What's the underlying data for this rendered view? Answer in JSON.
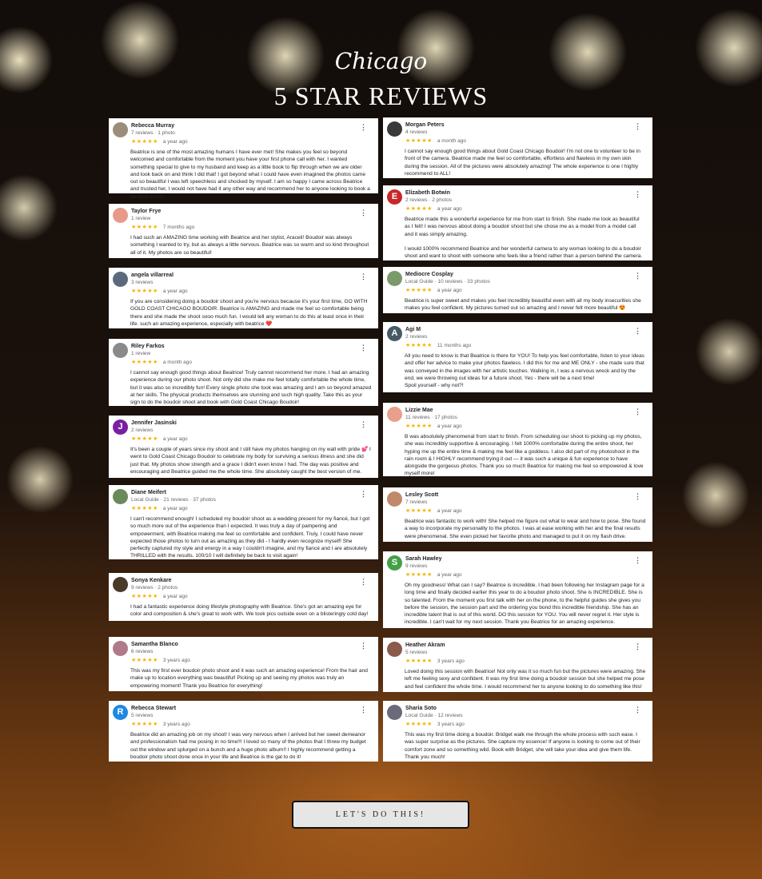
{
  "header": {
    "script": "Chicago",
    "title": "5 STAR REVIEWS"
  },
  "cta": {
    "label": "LET'S DO THIS!"
  },
  "menu_glyph": "⋮",
  "stars_glyph": "★★★★★",
  "colors": {
    "star": "#f4b400",
    "card_bg": "#ffffff",
    "cta_bg": "#e6e6e6"
  },
  "reviews": [
    {
      "name": "Rebecca Murray",
      "meta": "7 reviews · 1 photo",
      "ago": "a year ago",
      "avatar": "",
      "avatar_color": "#9c8c7a",
      "text": "Beatrice is one of the most amazing humans I have ever met! She makes you feel so beyond welcomed and comfortable from the moment you have your first phone call with her. I wanted something special to give to my husband and keep as a little book to flip through when we are older and look back on and think I did that! I got beyond what I could have even imagined the photos came out so beautiful I was left speechless and shocked by myself. I am so happy I came across Beatrice and trusted her, I would not have had it any other way and recommend her to anyone looking to book a boudoir shoot!"
    },
    {
      "name": "Taylor Frye",
      "meta": "1 review",
      "ago": "7 months ago",
      "avatar": "",
      "avatar_color": "#e89a8a",
      "text": "I had such an AMAZING time working with Beatrice and her stylist, Araceli! Boudoir was always something I wanted to try, but as always a little nervous. Beatrice was so warm and so kind throughout all of it. My photos are so beautiful!"
    },
    {
      "name": "angela villarreal",
      "meta": "3 reviews",
      "ago": "a year ago",
      "avatar": "",
      "avatar_color": "#5a6a7a",
      "text": "If you are considering doing a boudoir shoot and you're nervous because it's your first time, GO WITH GOLD COAST CHICAGO BOUDOIR. Beatrice is AMAZING and made me feel so comfortable being there and she made the shoot sooo much fun. I would tell any woman to do this at least once in their life. such an amazing experience, especially with beatrice ❤️"
    },
    {
      "name": "Riley Farkos",
      "meta": "1 review",
      "ago": "a month ago",
      "avatar": "",
      "avatar_color": "#8a8a8a",
      "text": "I cannot say enough good things about Beatrice! Truly cannot recommend her more. I had an amazing experience during our photo shoot. Not only did she make me feel totally comfortable the whole time, but it was also so incredibly fun! Every single photo she took was amazing and I am so beyond amazed at her skills. The physical products themselves are stunning and such high quality. Take this as your sign to do the boudoir shoot and book with Gold Coast Chicago Boudoir!"
    },
    {
      "name": "Jennifer Jasinski",
      "meta": "2 reviews",
      "ago": "a year ago",
      "avatar": "J",
      "avatar_color": "#7b1fa2",
      "text": "It's been a couple of years since my shoot and I still have my photos hanging on my wall with pride 💕 I went to Gold Coast Chicago Boudoir to celebrate my body for surviving a serious illness and she did just that. My photos show strength and a grace I didn't even know I had. The day was positive and encouraging and Beatrice guided me the whole time. She absolutely caught the best version of me."
    },
    {
      "name": "Diane Meifert",
      "meta": "Local Guide · 21 reviews · 37 photos",
      "ago": "a year ago",
      "avatar": "",
      "avatar_color": "#6a8a5a",
      "text": "I can't recommend enough! I scheduled my boudoir shoot as a wedding present for my fiancé, but I got so much more out of the experience than I expected. It was truly a day of pampering and empowerment, with Beatrice making me feel so comfortable and confident. Truly, I could have never expected those photos to turn out as amazing as they did - I hardly even recognize myself! She perfectly captured my style and energy in a way I couldn't imagine, and my fiancé and I are absolutely THRILLED with the results. 100/10 I will definitely be back to visit again!"
    },
    {
      "name": "Sonya Kenkare",
      "meta": "9 reviews · 2 photos",
      "ago": "a year ago",
      "avatar": "",
      "avatar_color": "#4a3a2a",
      "text": "I had a fantastic experience doing lifestyle photography with Beatrice. She's got an amazing eye for color and composition & she's great to work with. We took pics outside even on a blisteringly cold day!"
    },
    {
      "name": "Samantha Blanco",
      "meta": "6 reviews",
      "ago": "3 years ago",
      "avatar": "",
      "avatar_color": "#b07a8a",
      "text": "This was my first ever boudoir photo shoot and it was such an amazing experience! From the hair and make up to location everything was beautiful! Picking up and seeing my photos was truly an empowering moment! Thank you Beatrice for everything!"
    },
    {
      "name": "Rebecca Stewart",
      "meta": "5 reviews",
      "ago": "3 years ago",
      "avatar": "R",
      "avatar_color": "#1e88e5",
      "text": "Beatrice did an amazing job on my shoot! I was very nervous when I arrived but her sweet demeanor and professionalism had me posing in no time!!! I loved so many of the photos that I threw my budget out the window and splurged on a bunch and a huge photo album!! I highly recommend getting a boudoir photo shoot done once in your life and Beatrice is the gal to do it!"
    },
    {
      "name": "Morgan Peters",
      "meta": "4 reviews",
      "ago": "a month ago",
      "avatar": "",
      "avatar_color": "#3a3a3a",
      "text": "I cannot say enough good things about Gold Coast Chicago Boudoir! I'm not one to volunteer to be in front of the camera. Beatrice made me feel so comfortable, effortless and flawless in my own skin during the session. All of the pictures were absolutely amazing! The whole experience is one I highly recommend to ALL!"
    },
    {
      "name": "Elizabeth Botwin",
      "meta": "2 reviews · 2 photos",
      "ago": "a year ago",
      "avatar": "E",
      "avatar_color": "#c62828",
      "text": "Beatrice made this a wonderful experience for me from start to finish. She made me look as beautiful as I felt! I was nervous about doing a boudoir shoot but she chose me as a model from a model call and it was simply amazing.\n\nI would 1000% recommend Beatrice and her wonderful camera to any woman looking to do a boudoir shoot and want to shoot with someone who feels like a friend rather than a person behind the camera."
    },
    {
      "name": "Mediocre Cosplay",
      "meta": "Local Guide · 10 reviews · 33 photos",
      "ago": "a year ago",
      "avatar": "",
      "avatar_color": "#7a9a6a",
      "text": "Beatrice is super sweet and makes you feel incredibly beautiful even with all my body insecurities she makes you feel confident. My pictures turned out so amazing and I never felt more beautiful 😍"
    },
    {
      "name": "Agi M",
      "meta": "2 reviews",
      "ago": "11 months ago",
      "avatar": "A",
      "avatar_color": "#455a64",
      "text": "All you need to know is that Beatrice is there for YOU! To help you feel comfortable, listen to your ideas and offer her advice to make your photos flawless. I did this for me and ME ONLY - she made sure that was conveyed in the images with her artistic touches. Walking in, I was a nervous wreck and by the end, we were throwing out ideas for a future shoot. Yes - there will be a next time!\nSpoil yourself - why not?!"
    },
    {
      "name": "Lizzie Mae",
      "meta": "11 reviews · 17 photos",
      "ago": "a year ago",
      "avatar": "",
      "avatar_color": "#e8a08a",
      "text": "B was absolutely phenomenal from start to finish. From scheduling our shoot to picking up my photos, she was incredibly supportive & encouraging. I felt 1000% comfortable during the entire shoot, her hyping me up the entire time & making me feel like a goddess. I also did part of my photoshoot in the rain room & I HIGHLY recommend trying it out — it was such a unique & fun experience to have alongside the gorgeous photos. Thank you so much Beatrice for making me feel so empowered & love myself more!"
    },
    {
      "name": "Lesley Scott",
      "meta": "7 reviews",
      "ago": "a year ago",
      "avatar": "",
      "avatar_color": "#c08a6a",
      "text": "Beatrice was fantastic to work with! She helped me figure out what to wear and how to pose. She found a way to incorporate my personality to the photos. I was at ease working with her and the final results were phenomenal. She even picked her favorite photo and managed to put it on my flash drive."
    },
    {
      "name": "Sarah Hawley",
      "meta": "9 reviews",
      "ago": "a year ago",
      "avatar": "S",
      "avatar_color": "#43a047",
      "text": "Oh my goodness! What can I say? Beatrice is incredible. I had been following her Instagram page for a long time and finally decided earlier this year to do a boudoir photo shoot. She is INCREDIBLE. She is so talented. From the moment you first talk with her on the phone, to the helpful guides she gives you before the session, the session part and the ordering you bond this incredible friendship. She has an incredible talent that is out of this world. DO this session for YOU. You will never regret it. Her style is incredible. I can't wait for my next session. Thank you Beatrice for an amazing experience."
    },
    {
      "name": "Heather Akram",
      "meta": "5 reviews",
      "ago": "3 years ago",
      "avatar": "",
      "avatar_color": "#8a5a4a",
      "text": "Loved doing this session with Beatrice! Not only was it so much fun but the pictures were amazing. She left me feeling sexy and confident. It was my first time doing a boudoir session but she helped me pose and feel confident the whole time. I would recommend her to anyone looking to do something like this!"
    },
    {
      "name": "Sharia Soto",
      "meta": "Local Guide · 12 reviews",
      "ago": "3 years ago",
      "avatar": "",
      "avatar_color": "#6a6a7a",
      "text": "This was my first time doing a boudoir. Bridget walk me through the whole process with such ease. I was super surprise as the pictures. She capture my essence! If anyone is looking to come out of their comfort zone and so something wild. Book with Bridget, she will take your idea and give them life. Thank you much!"
    }
  ]
}
